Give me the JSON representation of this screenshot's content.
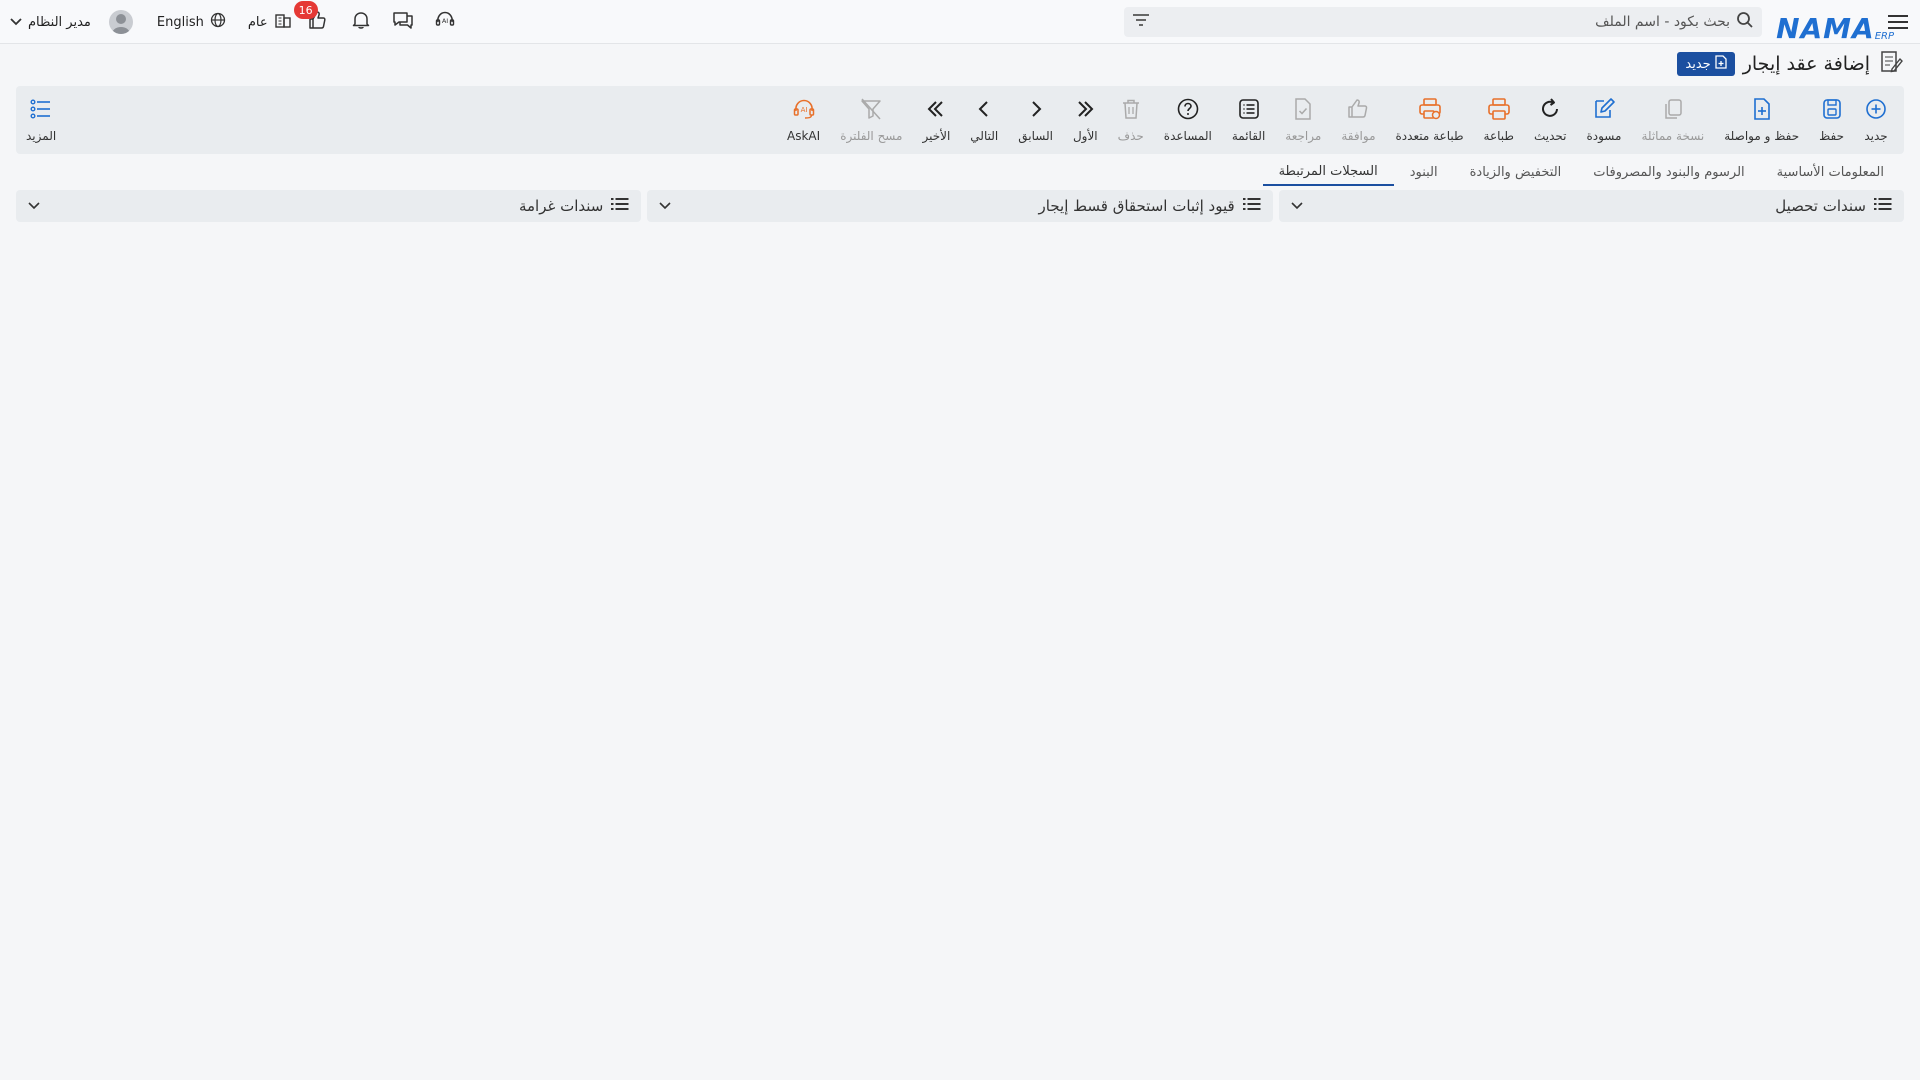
{
  "header": {
    "logo_text": "NAMA",
    "logo_sub": "ERP",
    "search_placeholder": "بحث بكود - اسم الملف",
    "user_name": "مدير النظام",
    "language": "English",
    "general_label": "عام",
    "notifications_count": "16"
  },
  "page": {
    "title": "إضافة عقد إيجار",
    "status_badge": "جديد"
  },
  "toolbar": {
    "items": [
      {
        "label": "جديد",
        "icon": "plus-circle-icon",
        "color": "#1f6fd1"
      },
      {
        "label": "حفظ",
        "icon": "save-icon",
        "color": "#1f6fd1"
      },
      {
        "label": "حفظ و مواصلة",
        "icon": "file-plus-icon",
        "color": "#1f6fd1"
      },
      {
        "label": "نسخة مماثلة",
        "icon": "copy-icon",
        "color": "#aaaaaa"
      },
      {
        "label": "مسودة",
        "icon": "edit-icon",
        "color": "#1f6fd1"
      },
      {
        "label": "تحديث",
        "icon": "refresh-icon",
        "color": "#222222"
      },
      {
        "label": "طباعة",
        "icon": "print-icon",
        "color": "#e8702a"
      },
      {
        "label": "طباعة متعددة",
        "icon": "multi-print-icon",
        "color": "#e8702a"
      },
      {
        "label": "موافقة",
        "icon": "thumbs-up-icon",
        "color": "#aaaaaa"
      },
      {
        "label": "مراجعة",
        "icon": "file-check-icon",
        "color": "#aaaaaa"
      },
      {
        "label": "القائمة",
        "icon": "list-icon",
        "color": "#222222"
      },
      {
        "label": "المساعدة",
        "icon": "help-icon",
        "color": "#222222"
      },
      {
        "label": "حذف",
        "icon": "trash-icon",
        "color": "#aaaaaa"
      },
      {
        "label": "الأول",
        "icon": "double-chevron-right-icon",
        "color": "#222222"
      },
      {
        "label": "السابق",
        "icon": "chevron-right-icon",
        "color": "#222222"
      },
      {
        "label": "التالي",
        "icon": "chevron-left-icon",
        "color": "#222222"
      },
      {
        "label": "الأخير",
        "icon": "double-chevron-left-icon",
        "color": "#222222"
      },
      {
        "label": "مسح الفلترة",
        "icon": "clear-filter-icon",
        "color": "#aaaaaa"
      },
      {
        "label": "AskAI",
        "icon": "ai-assistant-icon",
        "color": "#e8702a"
      }
    ],
    "more_label": "المزيد"
  },
  "tabs": [
    {
      "label": "المعلومات الأساسية",
      "active": false
    },
    {
      "label": "الرسوم والبنود والمصروفات",
      "active": false
    },
    {
      "label": "التخفيض والزيادة",
      "active": false
    },
    {
      "label": "البنود",
      "active": false
    },
    {
      "label": "السجلات المرتبطة",
      "active": true
    }
  ],
  "panels": [
    {
      "title": "سندات تحصيل"
    },
    {
      "title": "قيود إثبات استحقاق قسط إيجار"
    },
    {
      "title": "سندات غرامة"
    }
  ]
}
